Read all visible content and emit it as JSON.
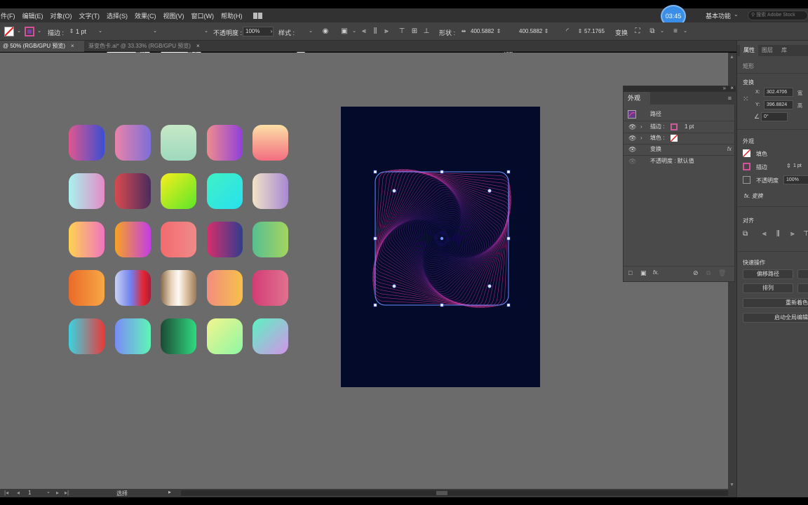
{
  "menu": [
    "件(F)",
    "编辑(E)",
    "对象(O)",
    "文字(T)",
    "选择(S)",
    "效果(C)",
    "视图(V)",
    "窗口(W)",
    "帮助(H)"
  ],
  "timer": "03:45",
  "workspace": "基本功能",
  "stock_search_placeholder": "搜索 Adobe Stock",
  "control_bar": {
    "stroke_label": "描边 :",
    "stroke_value": "1 pt",
    "profile_label": "等比",
    "brush_label": "基本",
    "opacity_label": "不透明度 :",
    "opacity_value": "100%",
    "style_label": "样式 :",
    "shape_label": "形状 :",
    "width_value": "400.5882",
    "height_value": "400.5882",
    "corner_value": "57.1765",
    "transform_label": "变换"
  },
  "tabs": [
    {
      "label": "@ 50% (RGB/GPU 预览)",
      "active": true
    },
    {
      "label": "渐变色卡.ai* @ 33.33% (RGB/GPU 预览)",
      "active": false
    }
  ],
  "tab_close": "×",
  "swatches": [
    [
      "#e0578f",
      "#3b4ed4"
    ],
    [
      "#e983a9",
      "#7d6fd8"
    ],
    [
      "#c6e8c7",
      "#9fd9bd"
    ],
    [
      "#f08b8e",
      "#8f3fdc"
    ],
    [
      "#fde0a6",
      "#f36d80"
    ],
    [
      "#a8f2ef",
      "#e58ac6"
    ],
    [
      "#d94a4f",
      "#4a2c5c"
    ],
    [
      "#f8ee1e",
      "#5be628"
    ],
    [
      "#3ff1c4",
      "#28e0f0"
    ],
    [
      "#f1e3c6",
      "#a689d2"
    ],
    [
      "#fdd34f",
      "#f173c2"
    ],
    [
      "#f6a423",
      "#c43ce6"
    ],
    [
      "#f36b6d",
      "#f08a8a"
    ],
    [
      "#d92e6a",
      "#303d8f"
    ],
    [
      "#56bf8f",
      "#a5d55f"
    ],
    [
      "#ea6a2a",
      "#f6a844"
    ],
    [
      "#c9d2f2",
      "#e8242e"
    ],
    [
      "#9f7e5a",
      "#f5ede0"
    ],
    [
      "#f48d7e",
      "#f5c04a"
    ],
    [
      "#d33c74",
      "#e07290"
    ],
    [
      "#3ad4e0",
      "#e83a3a"
    ],
    [
      "#7a8bf7",
      "#5ef6b6"
    ],
    [
      "#1b4a35",
      "#2fdb7f"
    ],
    [
      "#f3f58c",
      "#8ef7a5"
    ],
    [
      "#5bf3c1",
      "#d393e9"
    ]
  ],
  "appearance_panel": {
    "title": "外观",
    "object_type": "路径",
    "stroke_label": "描边 :",
    "stroke_value": "1 pt",
    "fill_label": "填色 :",
    "effect_label": "变换",
    "opacity_label": "不透明度 : 默认值",
    "fx": "fx"
  },
  "properties_panel": {
    "tabs": [
      "属性",
      "图层",
      "库"
    ],
    "object_type": "矩形",
    "transform_title": "变换",
    "x_label": "X:",
    "x_value": "302.4706",
    "y_label": "Y:",
    "y_value": "396.8824",
    "w_label": "宽",
    "h_label": "高",
    "angle_value": "0°",
    "appearance_title": "外观",
    "fill_label": "填色",
    "stroke_label": "描边",
    "stroke_value": "1 pt",
    "opacity_label": "不透明度",
    "opacity_value": "100%",
    "fx_label": "fx. 变换",
    "align_title": "对齐",
    "quick_actions_title": "快速操作",
    "offset_path": "偏移路径",
    "arrange": "排列",
    "recolor": "重新着色",
    "global_edit": "启动全局编辑"
  },
  "status_bar": {
    "page": "1",
    "mode": "选择"
  }
}
